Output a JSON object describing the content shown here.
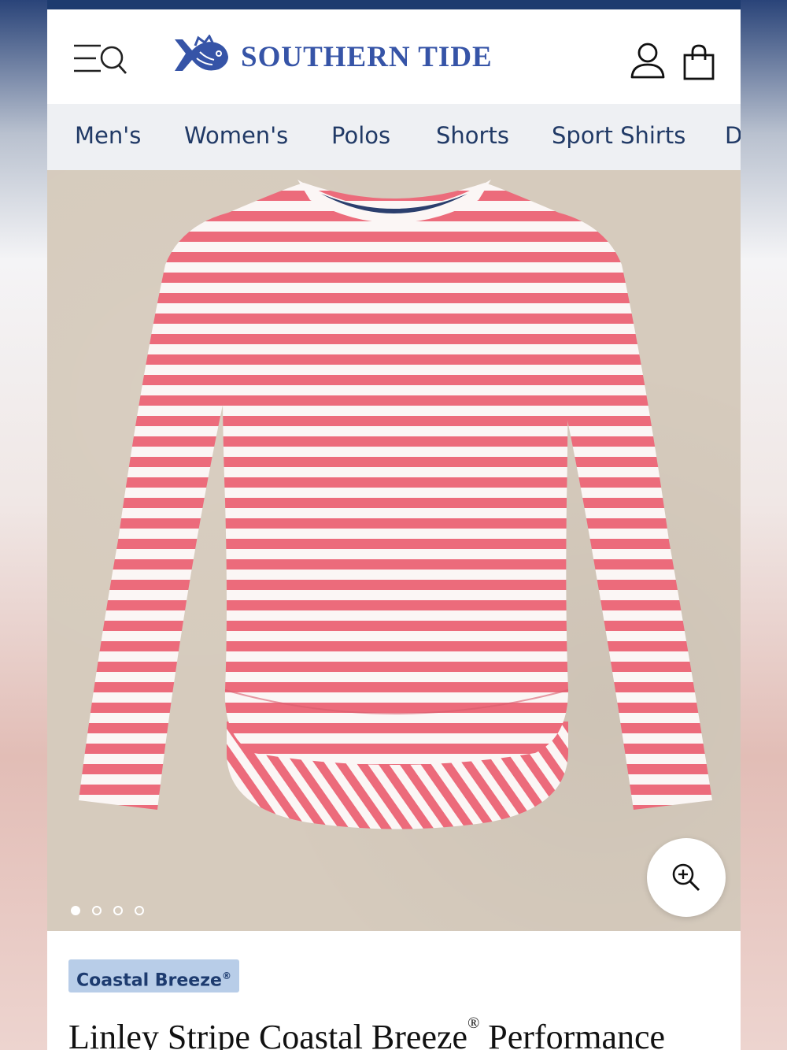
{
  "brand": {
    "name": "SOUTHERN TIDE"
  },
  "header": {
    "menu_icon": "menu-search-icon",
    "account_icon": "user-icon",
    "bag_icon": "shopping-bag-icon"
  },
  "nav": {
    "items": [
      {
        "label": "Men's"
      },
      {
        "label": "Women's"
      },
      {
        "label": "Polos"
      },
      {
        "label": "Shorts"
      },
      {
        "label": "Sport Shirts"
      },
      {
        "label": "D"
      }
    ]
  },
  "gallery": {
    "image_count": 4,
    "active_index": 0,
    "zoom_icon": "zoom-in-icon"
  },
  "product": {
    "collection_badge": "Coastal Breeze",
    "collection_badge_mark": "®",
    "title_part1": "Linley Stripe Coastal Breeze",
    "title_mark": "®",
    "title_part2": " Performance"
  },
  "colors": {
    "brand_navy": "#1d3b6f",
    "logo_blue": "#3654a7",
    "stripe_pink": "#ec6b7b",
    "badge_bg": "#b8cde8"
  }
}
